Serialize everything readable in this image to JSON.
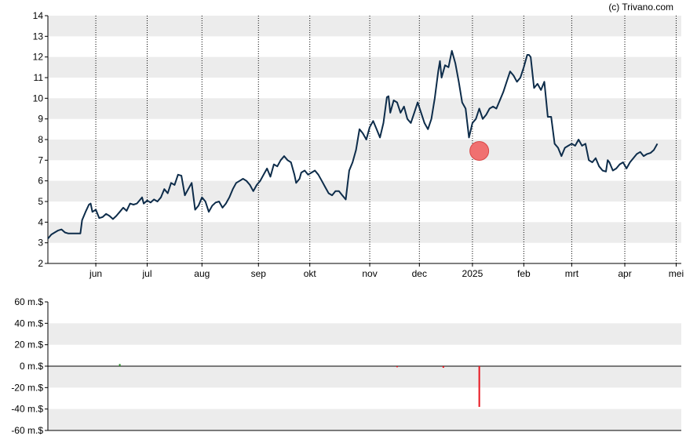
{
  "copyright": "(c) Trivano.com",
  "colors": {
    "price_line": "#0d2c4a",
    "band": "#ececec",
    "marker": "#f07070",
    "marker_stroke": "#d84848",
    "neg_bar": "#e8141e",
    "pos_bar": "#2a8a2a"
  },
  "chart_data": [
    {
      "type": "line",
      "ylim": [
        2,
        14
      ],
      "yticks": [
        2,
        3,
        4,
        5,
        6,
        7,
        8,
        9,
        10,
        11,
        12,
        13,
        14
      ],
      "x_range": [
        0,
        370
      ],
      "months": [
        {
          "label": "jun",
          "x": 28
        },
        {
          "label": "jul",
          "x": 58
        },
        {
          "label": "aug",
          "x": 90
        },
        {
          "label": "sep",
          "x": 123
        },
        {
          "label": "okt",
          "x": 153
        },
        {
          "label": "nov",
          "x": 188
        },
        {
          "label": "dec",
          "x": 217
        },
        {
          "label": "2025",
          "x": 248
        },
        {
          "label": "feb",
          "x": 278
        },
        {
          "label": "mrt",
          "x": 306
        },
        {
          "label": "apr",
          "x": 337
        },
        {
          "label": "mei",
          "x": 367
        }
      ],
      "series": [
        {
          "points": [
            [
              0,
              3.2
            ],
            [
              2,
              3.4
            ],
            [
              4,
              3.5
            ],
            [
              6,
              3.6
            ],
            [
              8,
              3.65
            ],
            [
              10,
              3.5
            ],
            [
              12,
              3.45
            ],
            [
              15,
              3.45
            ],
            [
              19,
              3.45
            ],
            [
              20,
              4.1
            ],
            [
              22,
              4.5
            ],
            [
              24,
              4.85
            ],
            [
              25,
              4.9
            ],
            [
              26,
              4.5
            ],
            [
              28,
              4.6
            ],
            [
              30,
              4.2
            ],
            [
              32,
              4.25
            ],
            [
              34,
              4.4
            ],
            [
              36,
              4.3
            ],
            [
              38,
              4.15
            ],
            [
              40,
              4.3
            ],
            [
              42,
              4.5
            ],
            [
              44,
              4.7
            ],
            [
              46,
              4.55
            ],
            [
              48,
              4.9
            ],
            [
              50,
              4.85
            ],
            [
              52,
              4.9
            ],
            [
              54,
              5.1
            ],
            [
              55,
              5.2
            ],
            [
              56,
              4.9
            ],
            [
              58,
              5.05
            ],
            [
              60,
              4.95
            ],
            [
              62,
              5.1
            ],
            [
              64,
              5.0
            ],
            [
              66,
              5.2
            ],
            [
              68,
              5.6
            ],
            [
              70,
              5.4
            ],
            [
              72,
              5.9
            ],
            [
              74,
              5.8
            ],
            [
              76,
              6.3
            ],
            [
              78,
              6.25
            ],
            [
              80,
              5.3
            ],
            [
              82,
              5.6
            ],
            [
              84,
              5.9
            ],
            [
              86,
              4.6
            ],
            [
              88,
              4.8
            ],
            [
              90,
              5.2
            ],
            [
              92,
              5.0
            ],
            [
              94,
              4.5
            ],
            [
              96,
              4.8
            ],
            [
              98,
              4.95
            ],
            [
              100,
              5.0
            ],
            [
              102,
              4.7
            ],
            [
              104,
              4.9
            ],
            [
              106,
              5.2
            ],
            [
              108,
              5.6
            ],
            [
              110,
              5.9
            ],
            [
              112,
              6.0
            ],
            [
              114,
              6.1
            ],
            [
              116,
              6.0
            ],
            [
              118,
              5.8
            ],
            [
              120,
              5.5
            ],
            [
              122,
              5.8
            ],
            [
              124,
              6.0
            ],
            [
              126,
              6.3
            ],
            [
              128,
              6.6
            ],
            [
              130,
              6.2
            ],
            [
              132,
              6.8
            ],
            [
              134,
              6.7
            ],
            [
              136,
              7.0
            ],
            [
              138,
              7.2
            ],
            [
              140,
              7.0
            ],
            [
              142,
              6.9
            ],
            [
              144,
              6.3
            ],
            [
              145,
              5.9
            ],
            [
              147,
              6.1
            ],
            [
              148,
              6.4
            ],
            [
              150,
              6.5
            ],
            [
              152,
              6.3
            ],
            [
              154,
              6.4
            ],
            [
              156,
              6.5
            ],
            [
              158,
              6.3
            ],
            [
              160,
              6.0
            ],
            [
              162,
              5.7
            ],
            [
              164,
              5.4
            ],
            [
              166,
              5.3
            ],
            [
              168,
              5.5
            ],
            [
              170,
              5.5
            ],
            [
              172,
              5.3
            ],
            [
              174,
              5.1
            ],
            [
              176,
              6.5
            ],
            [
              178,
              6.9
            ],
            [
              180,
              7.5
            ],
            [
              182,
              8.5
            ],
            [
              184,
              8.3
            ],
            [
              186,
              8.0
            ],
            [
              188,
              8.6
            ],
            [
              190,
              8.9
            ],
            [
              192,
              8.5
            ],
            [
              194,
              8.1
            ],
            [
              196,
              8.8
            ],
            [
              198,
              10.05
            ],
            [
              199,
              10.1
            ],
            [
              200,
              9.3
            ],
            [
              202,
              9.9
            ],
            [
              204,
              9.8
            ],
            [
              206,
              9.3
            ],
            [
              208,
              9.6
            ],
            [
              210,
              9.0
            ],
            [
              212,
              8.8
            ],
            [
              214,
              9.3
            ],
            [
              216,
              9.8
            ],
            [
              218,
              9.3
            ],
            [
              220,
              8.8
            ],
            [
              222,
              8.5
            ],
            [
              224,
              9.0
            ],
            [
              226,
              10.0
            ],
            [
              228,
              11.3
            ],
            [
              229,
              11.8
            ],
            [
              230,
              11.0
            ],
            [
              232,
              11.6
            ],
            [
              234,
              11.5
            ],
            [
              236,
              12.3
            ],
            [
              238,
              11.7
            ],
            [
              240,
              10.8
            ],
            [
              242,
              9.8
            ],
            [
              244,
              9.5
            ],
            [
              246,
              8.1
            ],
            [
              248,
              8.8
            ],
            [
              250,
              9.0
            ],
            [
              252,
              9.5
            ],
            [
              254,
              9.0
            ],
            [
              256,
              9.2
            ],
            [
              258,
              9.5
            ],
            [
              260,
              9.6
            ],
            [
              262,
              9.5
            ],
            [
              264,
              9.9
            ],
            [
              266,
              10.3
            ],
            [
              268,
              10.8
            ],
            [
              270,
              11.3
            ],
            [
              272,
              11.1
            ],
            [
              274,
              10.8
            ],
            [
              276,
              11.0
            ],
            [
              278,
              11.5
            ],
            [
              280,
              12.1
            ],
            [
              281,
              12.1
            ],
            [
              282,
              12.0
            ],
            [
              284,
              10.5
            ],
            [
              286,
              10.7
            ],
            [
              288,
              10.4
            ],
            [
              290,
              10.8
            ],
            [
              292,
              9.1
            ],
            [
              294,
              9.1
            ],
            [
              296,
              7.8
            ],
            [
              298,
              7.6
            ],
            [
              300,
              7.2
            ],
            [
              302,
              7.6
            ],
            [
              304,
              7.7
            ],
            [
              306,
              7.8
            ],
            [
              308,
              7.7
            ],
            [
              310,
              8.0
            ],
            [
              312,
              7.7
            ],
            [
              314,
              7.8
            ],
            [
              316,
              7.0
            ],
            [
              318,
              6.9
            ],
            [
              320,
              7.1
            ],
            [
              322,
              6.7
            ],
            [
              324,
              6.5
            ],
            [
              326,
              6.45
            ],
            [
              327,
              7.0
            ],
            [
              328,
              6.9
            ],
            [
              330,
              6.5
            ],
            [
              332,
              6.6
            ],
            [
              334,
              6.8
            ],
            [
              336,
              6.9
            ],
            [
              338,
              6.6
            ],
            [
              340,
              6.9
            ],
            [
              342,
              7.1
            ],
            [
              344,
              7.3
            ],
            [
              346,
              7.4
            ],
            [
              348,
              7.2
            ],
            [
              350,
              7.3
            ],
            [
              352,
              7.35
            ],
            [
              354,
              7.5
            ],
            [
              356,
              7.8
            ]
          ]
        }
      ],
      "marker": {
        "x": 252,
        "y": 7.45
      }
    },
    {
      "type": "bar",
      "ylim": [
        -60,
        60
      ],
      "yticks": [
        -60,
        -40,
        -20,
        0,
        20,
        40,
        60
      ],
      "ytick_labels": [
        "-60 m.$",
        "-40 m.$",
        "-20 m.$",
        "0 m.$",
        "20 m.$",
        "40 m.$",
        "60 m.$"
      ],
      "x_range": [
        0,
        370
      ],
      "bars": [
        {
          "x": 42,
          "value": 2.0
        },
        {
          "x": 204,
          "value": -1.0
        },
        {
          "x": 231,
          "value": -1.5
        },
        {
          "x": 252,
          "value": -38
        }
      ]
    }
  ]
}
